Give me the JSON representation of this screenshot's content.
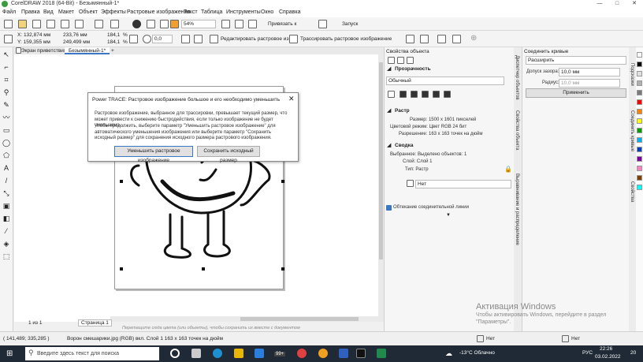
{
  "title_bar": {
    "title": "CorelDRAW 2018 (64-Bit) - Безымянный-1*",
    "minimize": "—",
    "maximize": "□",
    "close": "✕"
  },
  "menu": [
    "Файл",
    "Правка",
    "Вид",
    "Макет",
    "Объект",
    "Эффекты",
    "Растровые изображения",
    "Текст",
    "Таблица",
    "Инструменты",
    "Окно",
    "Справка"
  ],
  "standard_toolbar": {
    "zoom_value": "54%",
    "snap_label": "Привязать к",
    "launch_label": "Запуск"
  },
  "property_bar": {
    "x": "X: 132,874 мм",
    "y": "Y: 159,355 мм",
    "width": "233,76 мм",
    "height": "249,499 мм",
    "scale_w": "184,1",
    "scale_h": "184,1",
    "percent": "%",
    "rotation": "0,0",
    "edit_bitmap_label": "Редактировать растровое из...",
    "trace_bitmap_label": "Трассировать растровое изображение"
  },
  "doc_tabs": {
    "welcome": "Экран приветствия",
    "document": "Безымянный-1*",
    "add": "+"
  },
  "dialog": {
    "title": "Power TRACE: Растровое изображение большое и его необходимо уменьшить",
    "message1": "Растровое изображение, выбранное для трассировки, превышает текущий размер, что может привести к снижению быстродействия, если только изображение не будет уменьшено.",
    "message2": "Чтобы продолжить, выберите параметр \"Уменьшить растровое изображение\" для автоматического уменьшения изображения или выберите параметр \"Сохранить исходный размер\" для сохранения исходного размера растрового изображения.",
    "reduce_button": "Уменьшить растровое изображение",
    "keep_button": "Сохранить исходный размер",
    "close": "✕"
  },
  "object_properties": {
    "header": "Свойства объекта",
    "transparency_label": "Прозрачность",
    "transparency_mode": "Обычный",
    "bitmap_section": "Растр",
    "size": "Размер: 1500 x 1601 пикселей",
    "color_mode": "Цветовой режим: Цвет RGB 24 бит",
    "resolution": "Разрешение: 163 x 163 точек на дюйм",
    "summary_section": "Сводка",
    "selected": "Выбранное: Выделено объектов: 1",
    "layer": "Слой: Слой 1",
    "type": "Тип: Растр",
    "wrap_value": "Нет",
    "wrap_connector": "Обтекание соединительной линии"
  },
  "docker_tabs_1": [
    "Диспетчер объектов",
    "Свойства объекта",
    "Выравнивание и распределение"
  ],
  "connect_curves": {
    "header": "Соединить кривые",
    "mode": "Расширить",
    "gap_label": "Допуск зазора:",
    "gap_value": "10,0 мм",
    "radius_label": "Радиус:",
    "radius_value": "10,0 мм",
    "apply": "Применить"
  },
  "docker_tabs_2": [
    "Подсказки",
    "Соединить кривые",
    "Свойства"
  ],
  "page_nav": {
    "page_of": "1 из 1",
    "page_tab": "Страница 1"
  },
  "hint_bar": "Перетащите сюда цвета (или объекты), чтобы сохранить их вместе с документом",
  "status": {
    "coords": "( 141,489; 335,285 )",
    "object_info": "Ворон смешарики.jpg (RGB) вкл. Слой 1 163 x 163 точек на дюйм",
    "fill": "Нет",
    "outline": "Нет"
  },
  "watermark": {
    "line1": "Активация Windows",
    "line2": "Чтобы активировать Windows, перейдите в раздел \"Параметры\"."
  },
  "taskbar": {
    "search_placeholder": "Введите здесь текст для поиска",
    "badge": "99+",
    "weather": "-13°C Облачно",
    "lang": "РУС",
    "time": "22:26",
    "date": "03.02.2022",
    "notif": "20"
  },
  "palette_colors": [
    "#ffffff",
    "#000000",
    "#e0e0e0",
    "#b0b0b0",
    "#7a7a7a",
    "#ff0000",
    "#ff8000",
    "#ffff00",
    "#00a000",
    "#00b0f0",
    "#0040c0",
    "#8000a0",
    "#ff80c0",
    "#804000",
    "#00ffff"
  ]
}
